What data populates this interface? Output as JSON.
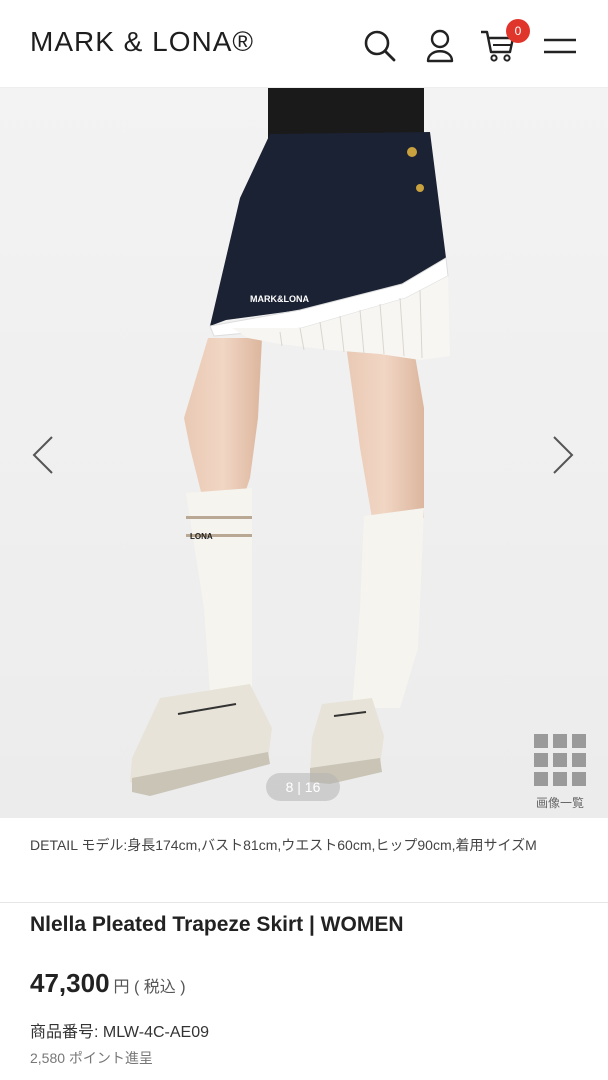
{
  "header": {
    "logo": "MARK & LONA®",
    "cart_count": "0"
  },
  "icons": {
    "search": "search-icon",
    "user": "user-icon",
    "cart": "cart-icon",
    "menu": "hamburger-menu-icon",
    "prev": "chevron-left-icon",
    "next": "chevron-right-icon",
    "grid": "grid-icon"
  },
  "gallery": {
    "counter": "8 | 16",
    "grid_label": "画像一覧",
    "skirt_brand": "MARK&LONA",
    "sock_text": "LONA"
  },
  "detail": {
    "text": "DETAIL モデル:身長174cm,バスト81cm,ウエスト60cm,ヒップ90cm,着用サイズM"
  },
  "product": {
    "title": "Nlella Pleated Trapeze Skirt | WOMEN",
    "price": "47,300",
    "price_unit": "円 ( 税込 )",
    "sku": "商品番号: MLW-4C-AE09",
    "points": "2,580 ポイント進呈"
  },
  "colors": {
    "badge": "#e0352b",
    "skirt": "#1b2233",
    "background": "#f2f2f2"
  }
}
